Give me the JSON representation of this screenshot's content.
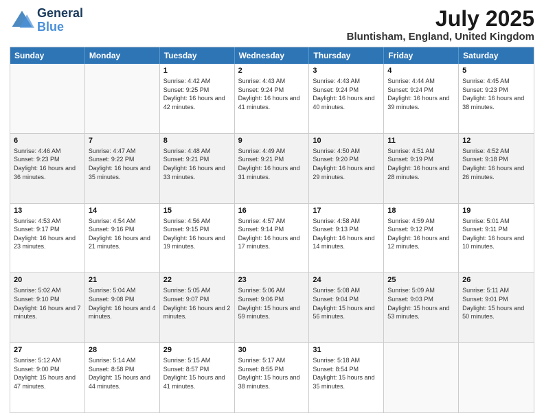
{
  "header": {
    "logo_line1": "General",
    "logo_line2": "Blue",
    "month_year": "July 2025",
    "location": "Bluntisham, England, United Kingdom"
  },
  "days_of_week": [
    "Sunday",
    "Monday",
    "Tuesday",
    "Wednesday",
    "Thursday",
    "Friday",
    "Saturday"
  ],
  "weeks": [
    [
      {
        "day": "",
        "info": "",
        "empty": true
      },
      {
        "day": "",
        "info": "",
        "empty": true
      },
      {
        "day": "1",
        "info": "Sunrise: 4:42 AM\nSunset: 9:25 PM\nDaylight: 16 hours\nand 42 minutes.",
        "empty": false
      },
      {
        "day": "2",
        "info": "Sunrise: 4:43 AM\nSunset: 9:24 PM\nDaylight: 16 hours\nand 41 minutes.",
        "empty": false
      },
      {
        "day": "3",
        "info": "Sunrise: 4:43 AM\nSunset: 9:24 PM\nDaylight: 16 hours\nand 40 minutes.",
        "empty": false
      },
      {
        "day": "4",
        "info": "Sunrise: 4:44 AM\nSunset: 9:24 PM\nDaylight: 16 hours\nand 39 minutes.",
        "empty": false
      },
      {
        "day": "5",
        "info": "Sunrise: 4:45 AM\nSunset: 9:23 PM\nDaylight: 16 hours\nand 38 minutes.",
        "empty": false
      }
    ],
    [
      {
        "day": "6",
        "info": "Sunrise: 4:46 AM\nSunset: 9:23 PM\nDaylight: 16 hours\nand 36 minutes.",
        "empty": false,
        "shaded": true
      },
      {
        "day": "7",
        "info": "Sunrise: 4:47 AM\nSunset: 9:22 PM\nDaylight: 16 hours\nand 35 minutes.",
        "empty": false,
        "shaded": true
      },
      {
        "day": "8",
        "info": "Sunrise: 4:48 AM\nSunset: 9:21 PM\nDaylight: 16 hours\nand 33 minutes.",
        "empty": false,
        "shaded": true
      },
      {
        "day": "9",
        "info": "Sunrise: 4:49 AM\nSunset: 9:21 PM\nDaylight: 16 hours\nand 31 minutes.",
        "empty": false,
        "shaded": true
      },
      {
        "day": "10",
        "info": "Sunrise: 4:50 AM\nSunset: 9:20 PM\nDaylight: 16 hours\nand 29 minutes.",
        "empty": false,
        "shaded": true
      },
      {
        "day": "11",
        "info": "Sunrise: 4:51 AM\nSunset: 9:19 PM\nDaylight: 16 hours\nand 28 minutes.",
        "empty": false,
        "shaded": true
      },
      {
        "day": "12",
        "info": "Sunrise: 4:52 AM\nSunset: 9:18 PM\nDaylight: 16 hours\nand 26 minutes.",
        "empty": false,
        "shaded": true
      }
    ],
    [
      {
        "day": "13",
        "info": "Sunrise: 4:53 AM\nSunset: 9:17 PM\nDaylight: 16 hours\nand 23 minutes.",
        "empty": false
      },
      {
        "day": "14",
        "info": "Sunrise: 4:54 AM\nSunset: 9:16 PM\nDaylight: 16 hours\nand 21 minutes.",
        "empty": false
      },
      {
        "day": "15",
        "info": "Sunrise: 4:56 AM\nSunset: 9:15 PM\nDaylight: 16 hours\nand 19 minutes.",
        "empty": false
      },
      {
        "day": "16",
        "info": "Sunrise: 4:57 AM\nSunset: 9:14 PM\nDaylight: 16 hours\nand 17 minutes.",
        "empty": false
      },
      {
        "day": "17",
        "info": "Sunrise: 4:58 AM\nSunset: 9:13 PM\nDaylight: 16 hours\nand 14 minutes.",
        "empty": false
      },
      {
        "day": "18",
        "info": "Sunrise: 4:59 AM\nSunset: 9:12 PM\nDaylight: 16 hours\nand 12 minutes.",
        "empty": false
      },
      {
        "day": "19",
        "info": "Sunrise: 5:01 AM\nSunset: 9:11 PM\nDaylight: 16 hours\nand 10 minutes.",
        "empty": false
      }
    ],
    [
      {
        "day": "20",
        "info": "Sunrise: 5:02 AM\nSunset: 9:10 PM\nDaylight: 16 hours\nand 7 minutes.",
        "empty": false,
        "shaded": true
      },
      {
        "day": "21",
        "info": "Sunrise: 5:04 AM\nSunset: 9:08 PM\nDaylight: 16 hours\nand 4 minutes.",
        "empty": false,
        "shaded": true
      },
      {
        "day": "22",
        "info": "Sunrise: 5:05 AM\nSunset: 9:07 PM\nDaylight: 16 hours\nand 2 minutes.",
        "empty": false,
        "shaded": true
      },
      {
        "day": "23",
        "info": "Sunrise: 5:06 AM\nSunset: 9:06 PM\nDaylight: 15 hours\nand 59 minutes.",
        "empty": false,
        "shaded": true
      },
      {
        "day": "24",
        "info": "Sunrise: 5:08 AM\nSunset: 9:04 PM\nDaylight: 15 hours\nand 56 minutes.",
        "empty": false,
        "shaded": true
      },
      {
        "day": "25",
        "info": "Sunrise: 5:09 AM\nSunset: 9:03 PM\nDaylight: 15 hours\nand 53 minutes.",
        "empty": false,
        "shaded": true
      },
      {
        "day": "26",
        "info": "Sunrise: 5:11 AM\nSunset: 9:01 PM\nDaylight: 15 hours\nand 50 minutes.",
        "empty": false,
        "shaded": true
      }
    ],
    [
      {
        "day": "27",
        "info": "Sunrise: 5:12 AM\nSunset: 9:00 PM\nDaylight: 15 hours\nand 47 minutes.",
        "empty": false
      },
      {
        "day": "28",
        "info": "Sunrise: 5:14 AM\nSunset: 8:58 PM\nDaylight: 15 hours\nand 44 minutes.",
        "empty": false
      },
      {
        "day": "29",
        "info": "Sunrise: 5:15 AM\nSunset: 8:57 PM\nDaylight: 15 hours\nand 41 minutes.",
        "empty": false
      },
      {
        "day": "30",
        "info": "Sunrise: 5:17 AM\nSunset: 8:55 PM\nDaylight: 15 hours\nand 38 minutes.",
        "empty": false
      },
      {
        "day": "31",
        "info": "Sunrise: 5:18 AM\nSunset: 8:54 PM\nDaylight: 15 hours\nand 35 minutes.",
        "empty": false
      },
      {
        "day": "",
        "info": "",
        "empty": true
      },
      {
        "day": "",
        "info": "",
        "empty": true
      }
    ]
  ]
}
